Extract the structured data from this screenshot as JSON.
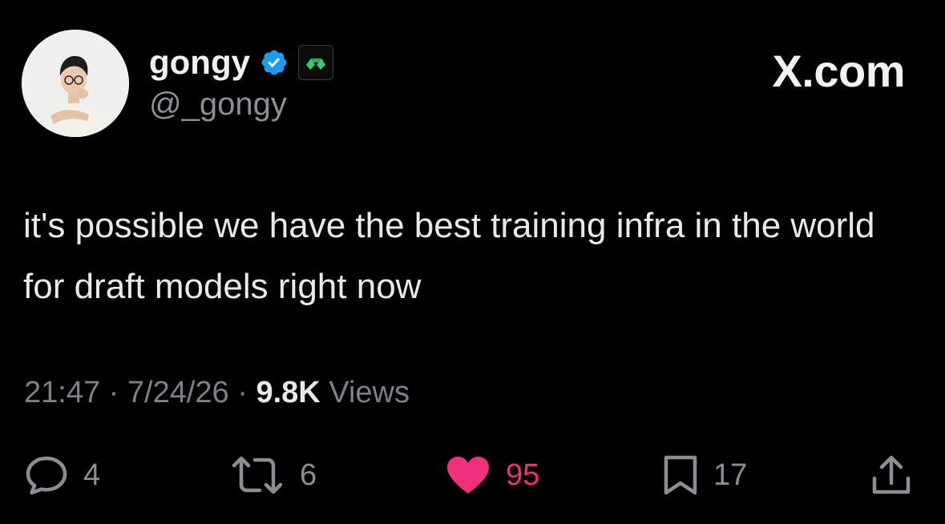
{
  "author": {
    "display_name": "gongy",
    "handle": "@_gongy",
    "avatar": "avatar-photo",
    "verified_icon": "verified-badge-icon",
    "affiliate_icon": "affiliate-badge-icon"
  },
  "brand": {
    "label": "X.com"
  },
  "tweet": {
    "text": "it's possible we have the best training infra in the world for draft models right now"
  },
  "meta": {
    "time": "21:47",
    "separator1": " · ",
    "date": "7/24/26",
    "separator2": " · ",
    "views_count": "9.8K",
    "views_label": " Views"
  },
  "actions": {
    "reply": {
      "icon": "reply-icon",
      "count": "4"
    },
    "retweet": {
      "icon": "retweet-icon",
      "count": "6"
    },
    "like": {
      "icon": "heart-icon",
      "count": "95"
    },
    "bookmark": {
      "icon": "bookmark-icon",
      "count": "17"
    },
    "share": {
      "icon": "share-icon"
    }
  },
  "colors": {
    "background": "#000000",
    "text": "#e7e9ea",
    "secondary": "#8b8f94",
    "verified": "#1d9bf0",
    "like": "#f0307c",
    "affiliate": "#2ecc71"
  }
}
